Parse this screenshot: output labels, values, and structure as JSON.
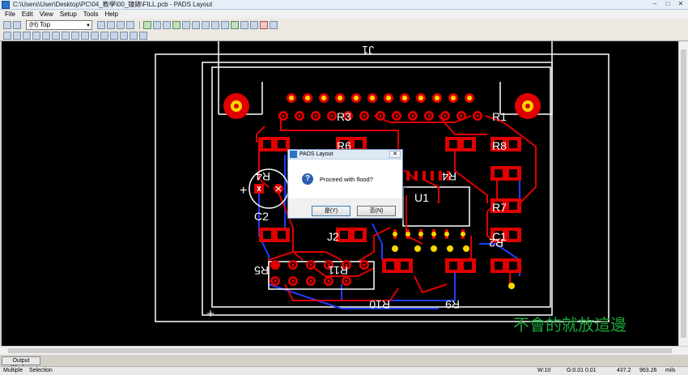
{
  "window": {
    "title": "C:\\Users\\User\\Desktop\\PC\\04_教學\\00_鐘錶\\FILL.pcb - PADS Layout",
    "minimize": "–",
    "maximize": "□",
    "close": "✕"
  },
  "menu": [
    "File",
    "Edit",
    "View",
    "Setup",
    "Tools",
    "Help"
  ],
  "toolbar": {
    "layer": "(H) Top"
  },
  "board": {
    "labels": {
      "J1": "J1",
      "R3": "R3",
      "R1": "R1",
      "R6": "R6",
      "R8": "R8",
      "R4": "R4",
      "R4b": "R4",
      "U1": "U1",
      "R7": "R7",
      "C2": "C2",
      "plus": "+",
      "J2": "J2",
      "C1": "C1",
      "R2": "R2",
      "R5": "R5",
      "R11": "R11",
      "R10": "R10",
      "R9": "R9"
    },
    "watermark": "不會的就放這邊"
  },
  "dialog": {
    "title": "PADS Layout",
    "close": "✕",
    "message": "Proceed with flood?",
    "icon": "?",
    "yes_button": "是(Y)",
    "no_button": "否(N)"
  },
  "output_window": "Output Window",
  "status": {
    "mode1": "Multiple",
    "mode2": "Selection",
    "width": "W:10",
    "grid": "G:0.01 0.01",
    "x": "437.2",
    "y": "963.26",
    "units": "mils"
  },
  "colors": {
    "trace_top": "#e00000",
    "trace_bottom": "#1e3cff",
    "outline": "#ffffff",
    "pad": "#e00000",
    "via": "#ffd700",
    "watermark": "#1aa83a"
  }
}
